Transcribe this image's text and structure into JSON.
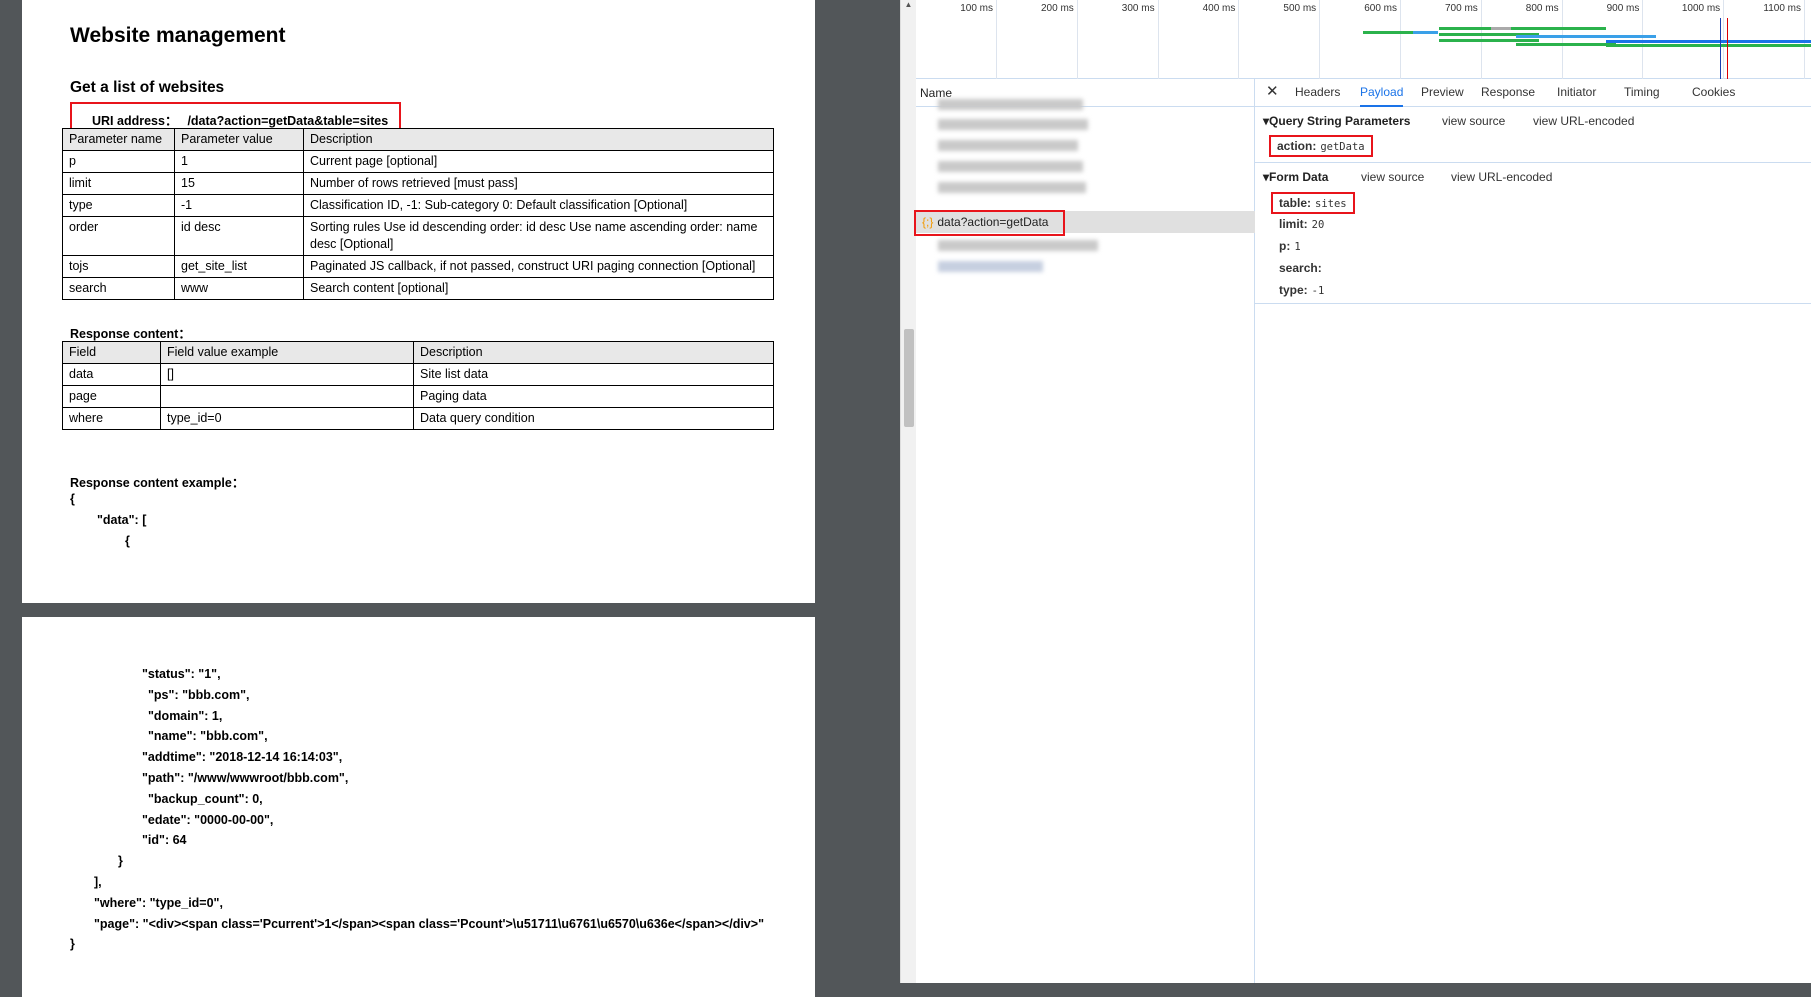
{
  "doc": {
    "title": "Website management",
    "section": "Get a list of websites",
    "uri_label": "URI address：",
    "uri_value": "/data?action=getData&table=sites",
    "params_table": {
      "headers": [
        "Parameter name",
        "Parameter value",
        "Description"
      ],
      "rows": [
        [
          "p",
          "1",
          "Current page [optional]"
        ],
        [
          "limit",
          "15",
          "Number of rows retrieved [must pass]"
        ],
        [
          "type",
          "-1",
          "Classification ID, -1: Sub-category 0: Default classification [Optional]"
        ],
        [
          "order",
          "id desc",
          "Sorting rules Use id descending order: id desc Use name ascending order: name desc [Optional]"
        ],
        [
          "tojs",
          "get_site_list",
          "Paginated JS callback, if not passed, construct URI paging connection [Optional]"
        ],
        [
          "search",
          "www",
          "Search content [optional]"
        ]
      ]
    },
    "response_label": "Response content：",
    "response_table": {
      "headers": [
        "Field",
        "Field value example",
        "Description"
      ],
      "rows": [
        [
          "data",
          "[]",
          "Site list data"
        ],
        [
          "page",
          "",
          "Paging data"
        ],
        [
          "where",
          "type_id=0",
          "Data query condition"
        ]
      ]
    },
    "example_label": "Response content example：",
    "example_page1": [
      "{",
      "\"data\": [",
      "{"
    ],
    "example_page2": [
      "\"status\": \"1\",",
      "\"ps\": \"bbb.com\",",
      "\"domain\": 1,",
      "\"name\": \"bbb.com\",",
      "\"addtime\": \"2018-12-14 16:14:03\",",
      "\"path\": \"/www/wwwroot/bbb.com\",",
      "\"backup_count\": 0,",
      "\"edate\": \"0000-00-00\",",
      "\"id\": 64",
      "}",
      "],",
      "\"where\": \"type_id=0\",",
      "\"page\": \"<div><span class='Pcurrent'>1</span><span class='Pcount'>\\u51711\\u6761\\u6570\\u636e</span></div>\"",
      "}"
    ]
  },
  "devtools": {
    "timeline_ticks": [
      "100 ms",
      "200 ms",
      "300 ms",
      "400 ms",
      "500 ms",
      "600 ms",
      "700 ms",
      "800 ms",
      "900 ms",
      "1000 ms",
      "1100 ms"
    ],
    "name_header": "Name",
    "selected_request": "data?action=getData",
    "tabs": [
      "Headers",
      "Payload",
      "Preview",
      "Response",
      "Initiator",
      "Timing",
      "Cookies"
    ],
    "active_tab": "Payload",
    "query": {
      "title": "Query String Parameters",
      "view_source": "view source",
      "view_encoded": "view URL-encoded",
      "params": [
        {
          "key": "action:",
          "value": "getData"
        }
      ]
    },
    "form": {
      "title": "Form Data",
      "view_source": "view source",
      "view_encoded": "view URL-encoded",
      "params": [
        {
          "key": "table:",
          "value": "sites"
        },
        {
          "key": "limit:",
          "value": "20"
        },
        {
          "key": "p:",
          "value": "1"
        },
        {
          "key": "search:",
          "value": ""
        },
        {
          "key": "type:",
          "value": "-1"
        }
      ]
    },
    "colors": {
      "accent": "#1a73e8",
      "highlight": "#e8141b"
    }
  }
}
